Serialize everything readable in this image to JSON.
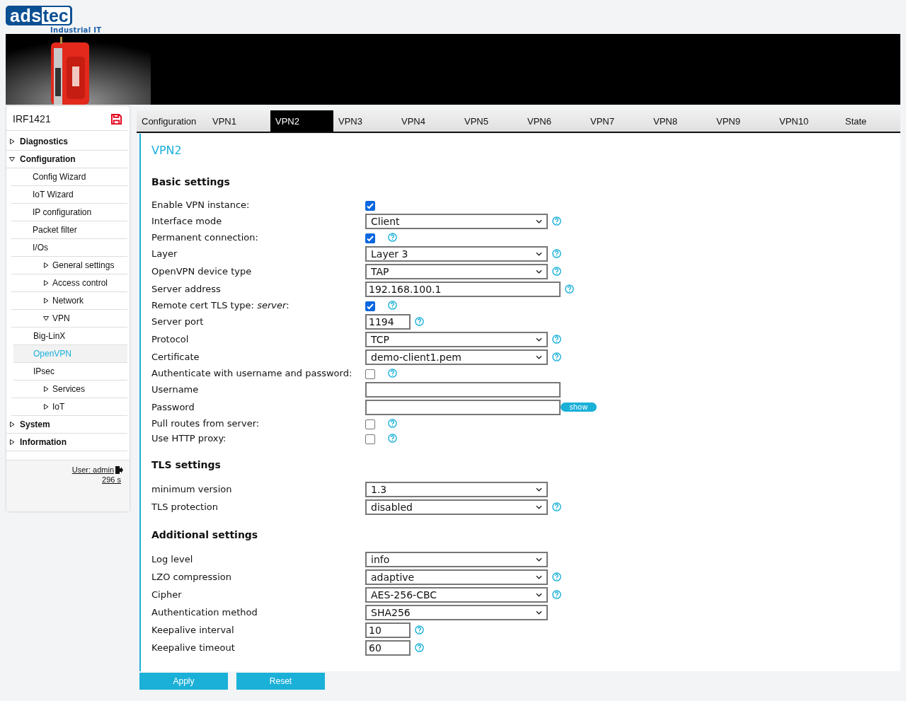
{
  "logo": {
    "left": "ads",
    "right": "tec",
    "tagline": "Industrial IT"
  },
  "header": {
    "kind": "picture"
  },
  "sidebar": {
    "device": "IRF1421",
    "items": [
      {
        "kind": "group",
        "label": "Diagnostics",
        "expanded": false,
        "selected": false
      },
      {
        "kind": "group",
        "label": "Configuration",
        "expanded": true,
        "selected": false,
        "children": [
          {
            "kind": "link",
            "label": "Config Wizard",
            "selected": false
          },
          {
            "kind": "link",
            "label": "IoT Wizard",
            "selected": false
          },
          {
            "kind": "link",
            "label": "IP configuration",
            "selected": false
          },
          {
            "kind": "link",
            "label": "Packet filter",
            "selected": false
          },
          {
            "kind": "link",
            "label": "I/Os",
            "selected": false,
            "children": [
              {
                "kind": "group",
                "label": "General settings",
                "expanded": false,
                "selected": false
              },
              {
                "kind": "group",
                "label": "Access control",
                "expanded": false,
                "selected": false
              },
              {
                "kind": "group",
                "label": "Network",
                "expanded": false,
                "selected": false
              },
              {
                "kind": "group",
                "label": "VPN",
                "expanded": true,
                "selected": false,
                "children": [
                  {
                    "kind": "link",
                    "label": "Big-LinX",
                    "selected": false
                  },
                  {
                    "kind": "link",
                    "label": "OpenVPN",
                    "selected": true
                  },
                  {
                    "kind": "link",
                    "label": "IPsec",
                    "selected": false
                  }
                ]
              },
              {
                "kind": "group",
                "label": "Services",
                "expanded": false,
                "selected": false
              },
              {
                "kind": "group",
                "label": "IoT",
                "expanded": false,
                "selected": false
              }
            ]
          }
        ]
      },
      {
        "kind": "group",
        "label": "System",
        "expanded": false,
        "selected": false
      },
      {
        "kind": "group",
        "label": "Information",
        "expanded": false,
        "selected": false
      }
    ],
    "user": "User: admin",
    "timer": "296 s"
  },
  "tabs": [
    {
      "label": "Configuration",
      "selected": false
    },
    {
      "label": "VPN1",
      "selected": false
    },
    {
      "label": "VPN2",
      "selected": true
    },
    {
      "label": "VPN3",
      "selected": false
    },
    {
      "label": "VPN4",
      "selected": false
    },
    {
      "label": "VPN5",
      "selected": false
    },
    {
      "label": "VPN6",
      "selected": false
    },
    {
      "label": "VPN7",
      "selected": false
    },
    {
      "label": "VPN8",
      "selected": false
    },
    {
      "label": "VPN9",
      "selected": false
    },
    {
      "label": "VPN10",
      "selected": false
    },
    {
      "label": "State",
      "selected": false
    }
  ],
  "page_title": "VPN2",
  "sections": [
    {
      "title": "Basic settings",
      "fields": [
        {
          "kind": "checkbox",
          "label": "Enable VPN instance:",
          "checked": true,
          "help": false
        },
        {
          "kind": "select",
          "label": "Interface mode",
          "value": "Client",
          "help": true
        },
        {
          "kind": "checkbox",
          "label": "Permanent connection:",
          "checked": true,
          "help": true
        },
        {
          "kind": "select",
          "label": "Layer",
          "value": "Layer 3",
          "help": true
        },
        {
          "kind": "select",
          "label": "OpenVPN device type",
          "value": "TAP",
          "help": true
        },
        {
          "kind": "text",
          "label": "Server address",
          "value": "192.168.100.1",
          "help": true
        },
        {
          "kind": "checkbox",
          "label": "Remote cert TLS type: *server*:",
          "checked": true,
          "help": true
        },
        {
          "kind": "short",
          "label": "Server port",
          "value": "1194",
          "help": true
        },
        {
          "kind": "select",
          "label": "Protocol",
          "value": "TCP",
          "help": true
        },
        {
          "kind": "select",
          "label": "Certificate",
          "value": "demo-client1.pem",
          "help": true
        },
        {
          "kind": "checkbox",
          "label": "Authenticate with username and password:",
          "checked": false,
          "help": true
        },
        {
          "kind": "text",
          "label": "Username",
          "help": false
        },
        {
          "kind": "password",
          "label": "Password",
          "help": false,
          "button": "show"
        },
        {
          "kind": "checkbox",
          "label": "Pull routes from server:",
          "checked": false,
          "help": true
        },
        {
          "kind": "checkbox",
          "label": "Use HTTP proxy:",
          "checked": false,
          "help": true
        }
      ]
    },
    {
      "title": "TLS settings",
      "fields": [
        {
          "kind": "select",
          "label": "minimum version",
          "value": "1.3",
          "help": false
        },
        {
          "kind": "select",
          "label": "TLS protection",
          "value": "disabled",
          "help": true
        }
      ]
    },
    {
      "title": "Additional settings",
      "fields": [
        {
          "kind": "select",
          "label": "Log level",
          "value": "info",
          "help": false
        },
        {
          "kind": "select",
          "label": "LZO compression",
          "value": "adaptive",
          "help": true
        },
        {
          "kind": "select",
          "label": "Cipher",
          "value": "AES-256-CBC",
          "help": true
        },
        {
          "kind": "select",
          "label": "Authentication method",
          "value": "SHA256",
          "help": false
        },
        {
          "kind": "short",
          "label": "Keepalive interval",
          "value": "10",
          "help": true
        },
        {
          "kind": "short",
          "label": "Keepalive timeout",
          "value": "60",
          "help": true
        }
      ]
    }
  ],
  "buttons": [
    "Apply",
    "Reset"
  ]
}
